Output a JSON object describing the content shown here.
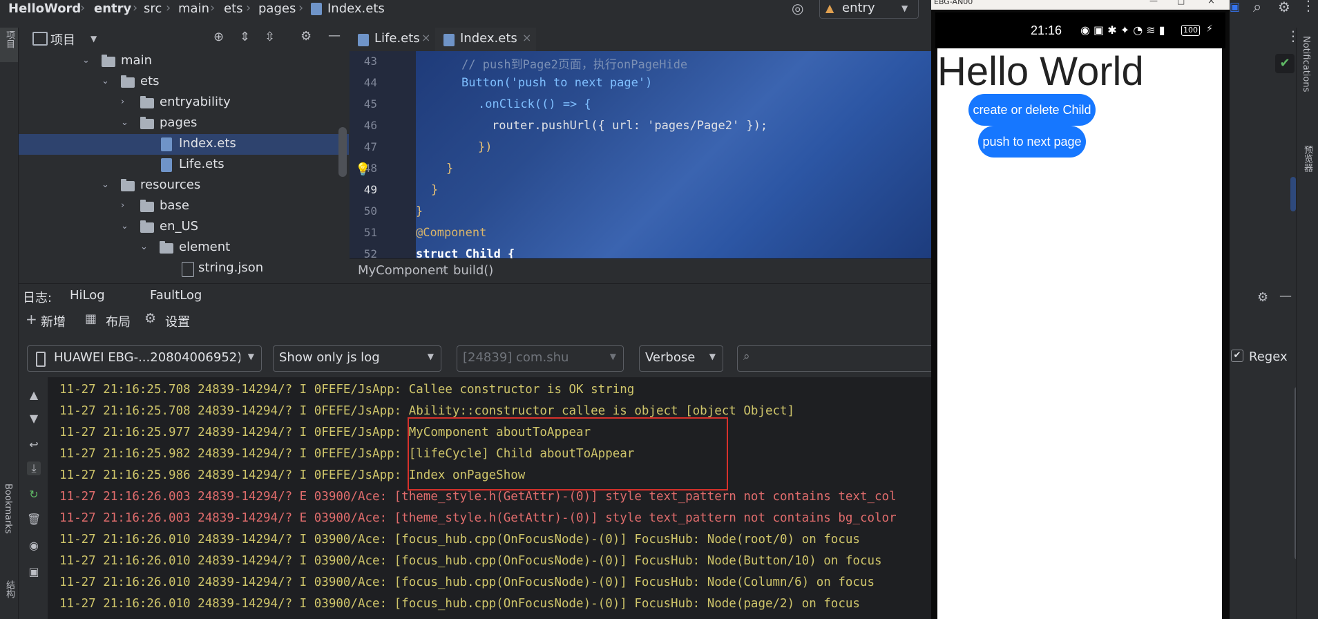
{
  "breadcrumb": [
    "HelloWord",
    "entry",
    "src",
    "main",
    "ets",
    "pages",
    "Index.ets"
  ],
  "run_config": "entry",
  "project_panel": {
    "title": "项目",
    "tree": [
      {
        "label": "main",
        "type": "folder",
        "expanded": true
      },
      {
        "label": "ets",
        "type": "folder",
        "expanded": true
      },
      {
        "label": "entryability",
        "type": "folder",
        "expanded": false
      },
      {
        "label": "pages",
        "type": "folder",
        "expanded": true
      },
      {
        "label": "Index.ets",
        "type": "file",
        "selected": true
      },
      {
        "label": "Life.ets",
        "type": "file"
      },
      {
        "label": "resources",
        "type": "folder",
        "expanded": true
      },
      {
        "label": "base",
        "type": "folder",
        "expanded": false
      },
      {
        "label": "en_US",
        "type": "folder",
        "expanded": true
      },
      {
        "label": "element",
        "type": "folder",
        "expanded": true
      },
      {
        "label": "string.json",
        "type": "json"
      }
    ]
  },
  "editor": {
    "tabs": [
      {
        "label": "Life.ets",
        "active": false
      },
      {
        "label": "Index.ets",
        "active": true
      }
    ],
    "line_numbers": [
      "43",
      "44",
      "45",
      "46",
      "47",
      "48",
      "49",
      "50",
      "51",
      "52"
    ],
    "code": [
      "// push到Page2页面，执行onPageHide",
      "Button('push to next page')",
      ".onClick(() => {",
      "router.pushUrl({ url: 'pages/Page2' });",
      "})",
      "}",
      "}",
      "}",
      "@Component",
      "struct Child {"
    ],
    "breadcrumb": [
      "MyComponent",
      "build()"
    ]
  },
  "log_panel": {
    "label": "日志:",
    "tabs": [
      "HiLog",
      "FaultLog"
    ],
    "toolbar": {
      "new": "新增",
      "layout": "布局",
      "settings": "设置"
    },
    "device": "HUAWEI EBG-...20804006952)",
    "filter_mode": "Show only js log",
    "process": "[24839] com.shu",
    "level": "Verbose",
    "search_placeholder": "",
    "regex_label": "Regex",
    "regex_checked": true,
    "lines": [
      {
        "text": "11-27 21:16:25.708 24839-14294/? I 0FEFE/JsApp: Callee constructor is OK string",
        "level": "info"
      },
      {
        "text": "11-27 21:16:25.708 24839-14294/? I 0FEFE/JsApp: Ability::constructor callee is object [object Object]",
        "level": "info"
      },
      {
        "text": "11-27 21:16:25.977 24839-14294/? I 0FEFE/JsApp: MyComponent aboutToAppear",
        "level": "info"
      },
      {
        "text": "11-27 21:16:25.982 24839-14294/? I 0FEFE/JsApp: [lifeCycle] Child aboutToAppear",
        "level": "info"
      },
      {
        "text": "11-27 21:16:25.986 24839-14294/? I 0FEFE/JsApp: Index onPageShow",
        "level": "info"
      },
      {
        "text": "11-27 21:16:26.003 24839-14294/? E 03900/Ace: [theme_style.h(GetAttr)-(0)] style text_pattern not contains text_col",
        "level": "error"
      },
      {
        "text": "11-27 21:16:26.003 24839-14294/? E 03900/Ace: [theme_style.h(GetAttr)-(0)] style text_pattern not contains bg_color",
        "level": "error"
      },
      {
        "text": "11-27 21:16:26.010 24839-14294/? I 03900/Ace: [focus_hub.cpp(OnFocusNode)-(0)] FocusHub: Node(root/0) on focus",
        "level": "info"
      },
      {
        "text": "11-27 21:16:26.010 24839-14294/? I 03900/Ace: [focus_hub.cpp(OnFocusNode)-(0)] FocusHub: Node(Button/10) on focus",
        "level": "info"
      },
      {
        "text": "11-27 21:16:26.010 24839-14294/? I 03900/Ace: [focus_hub.cpp(OnFocusNode)-(0)] FocusHub: Node(Column/6) on focus",
        "level": "info"
      },
      {
        "text": "11-27 21:16:26.010 24839-14294/? I 03900/Ace: [focus_hub.cpp(OnFocusNode)-(0)] FocusHub: Node(page/2) on focus",
        "level": "info"
      }
    ]
  },
  "left_strip": {
    "project": "项目",
    "bookmarks": "Bookmarks",
    "structure": "结构"
  },
  "right_strip": {
    "notifications": "Notifications",
    "preview": "预览器"
  },
  "emulator": {
    "window_title": "EBG-AN00",
    "time": "21:16",
    "battery": "100",
    "hello_text": "Hello World",
    "buttons": [
      "create or delete Child",
      "push to next page"
    ]
  },
  "colors": {
    "accent": "#3574f0",
    "phone_button": "#1677ff",
    "log_info": "#cfc56a",
    "log_error": "#e06c6c",
    "highlight_box": "#d8312b"
  }
}
